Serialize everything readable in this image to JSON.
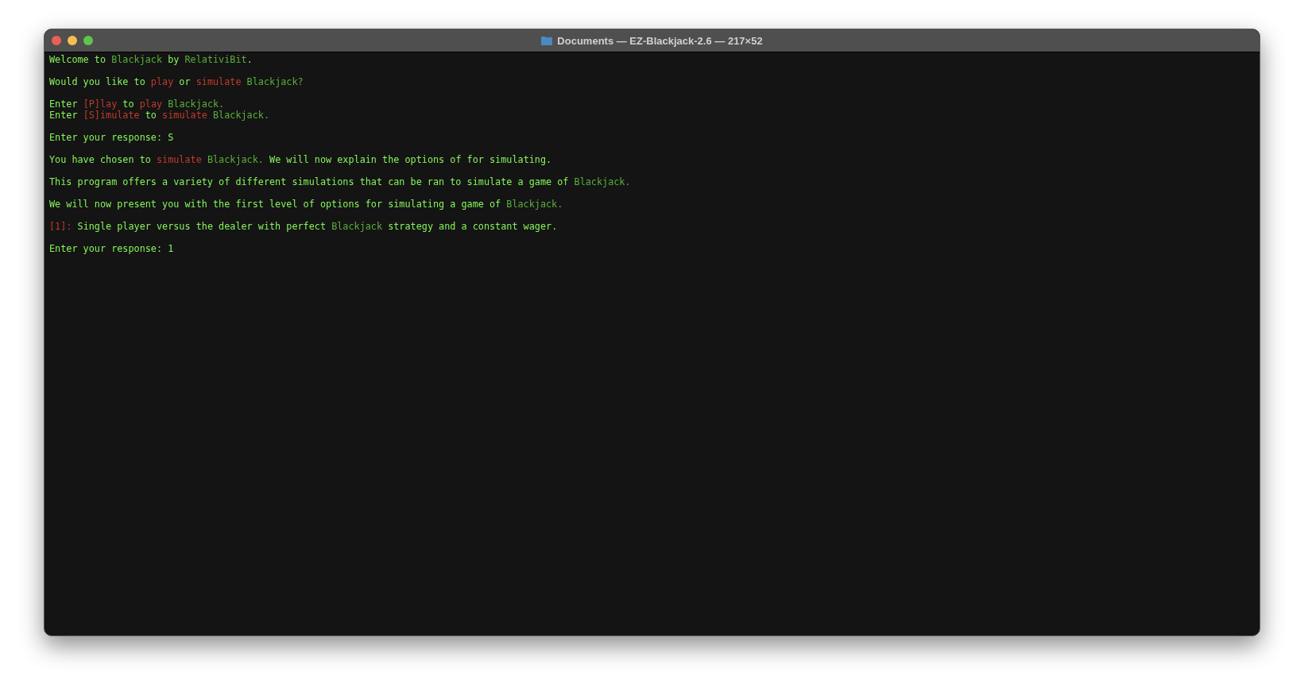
{
  "window": {
    "title": "Documents — EZ-Blackjack-2.6 — 217×52"
  },
  "terminal": {
    "lines": [
      {
        "kind": "text",
        "segments": [
          {
            "text": "Welcome to ",
            "kind": "plain"
          },
          {
            "text": "Blackjack",
            "kind": "name"
          },
          {
            "text": " by ",
            "kind": "plain"
          },
          {
            "text": "RelativiBit",
            "kind": "name"
          },
          {
            "text": ".",
            "kind": "plain"
          }
        ]
      },
      {
        "kind": "blank"
      },
      {
        "kind": "text",
        "segments": [
          {
            "text": "Would you like to ",
            "kind": "plain"
          },
          {
            "text": "play",
            "kind": "option"
          },
          {
            "text": " or ",
            "kind": "plain"
          },
          {
            "text": "simulate",
            "kind": "option"
          },
          {
            "text": " Blackjack?",
            "kind": "name"
          }
        ]
      },
      {
        "kind": "blank"
      },
      {
        "kind": "text",
        "segments": [
          {
            "text": "Enter ",
            "kind": "plain"
          },
          {
            "text": "[P]lay",
            "kind": "option"
          },
          {
            "text": " to ",
            "kind": "plain"
          },
          {
            "text": "play",
            "kind": "option"
          },
          {
            "text": " Blackjack.",
            "kind": "name"
          }
        ]
      },
      {
        "kind": "text",
        "segments": [
          {
            "text": "Enter ",
            "kind": "plain"
          },
          {
            "text": "[S]imulate",
            "kind": "option"
          },
          {
            "text": " to ",
            "kind": "plain"
          },
          {
            "text": "simulate",
            "kind": "option"
          },
          {
            "text": " Blackjack.",
            "kind": "name"
          }
        ]
      },
      {
        "kind": "blank"
      },
      {
        "kind": "text",
        "segments": [
          {
            "text": "Enter your response: S",
            "kind": "plain"
          }
        ]
      },
      {
        "kind": "blank"
      },
      {
        "kind": "text",
        "segments": [
          {
            "text": "You have chosen to ",
            "kind": "plain"
          },
          {
            "text": "simulate",
            "kind": "option"
          },
          {
            "text": " Blackjack.",
            "kind": "name"
          },
          {
            "text": " We will now explain the options of for simulating.",
            "kind": "plain"
          }
        ]
      },
      {
        "kind": "blank"
      },
      {
        "kind": "text",
        "segments": [
          {
            "text": "This program offers a variety of different simulations that can be ran to simulate a game of ",
            "kind": "plain"
          },
          {
            "text": "Blackjack.",
            "kind": "name"
          }
        ]
      },
      {
        "kind": "blank"
      },
      {
        "kind": "text",
        "segments": [
          {
            "text": "We will now present you with the first level of options for simulating a game of ",
            "kind": "plain"
          },
          {
            "text": "Blackjack.",
            "kind": "name"
          }
        ]
      },
      {
        "kind": "blank"
      },
      {
        "kind": "text",
        "segments": [
          {
            "text": "[1]:",
            "kind": "option"
          },
          {
            "text": " Single player versus the dealer with perfect ",
            "kind": "plain"
          },
          {
            "text": "Blackjack",
            "kind": "name"
          },
          {
            "text": " strategy and a constant wager.",
            "kind": "plain"
          }
        ]
      },
      {
        "kind": "blank"
      },
      {
        "kind": "text",
        "segments": [
          {
            "text": "Enter your response: 1",
            "kind": "plain"
          }
        ]
      }
    ]
  }
}
